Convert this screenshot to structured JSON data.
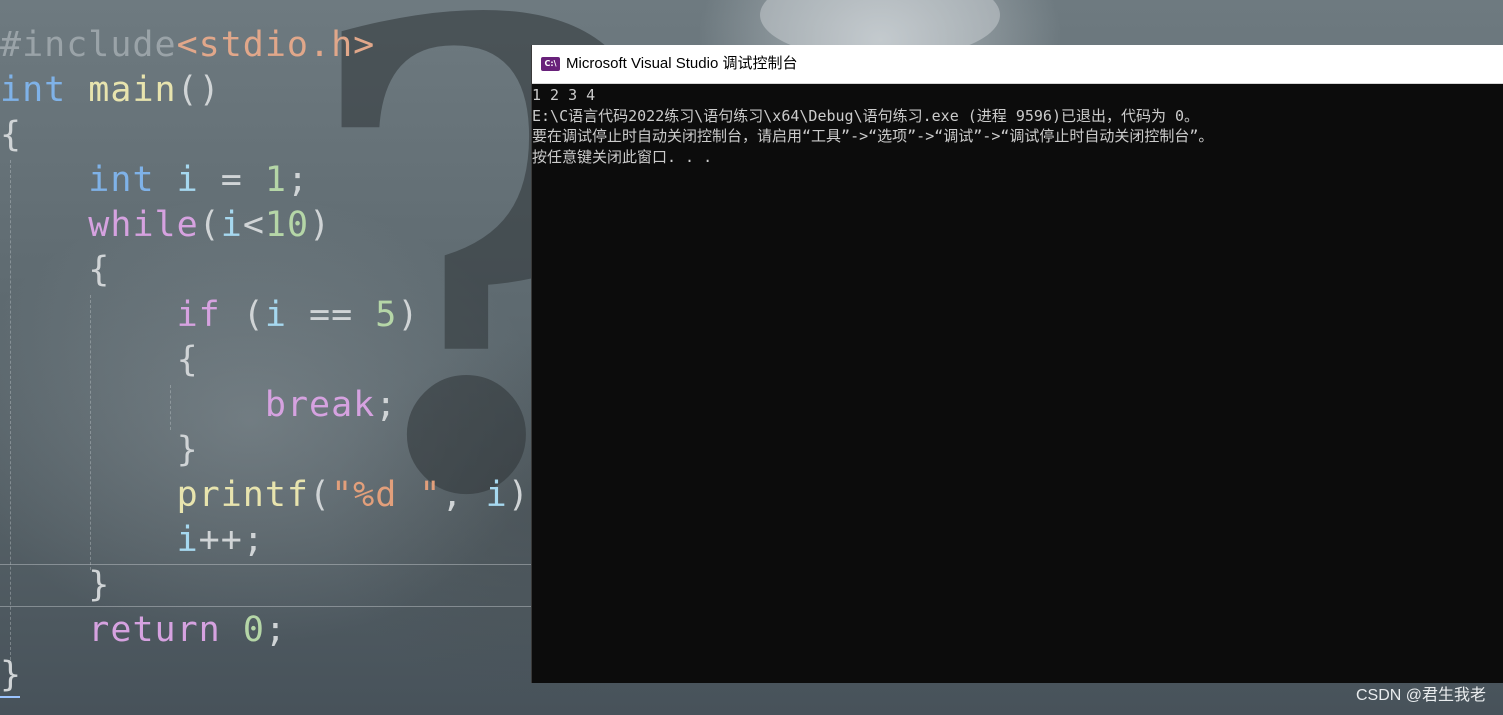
{
  "editor": {
    "lines": [
      [
        {
          "t": "#include",
          "c": "c-pre"
        },
        {
          "t": "<stdio.h>",
          "c": "c-inc"
        }
      ],
      [
        {
          "t": "int",
          "c": "c-kw"
        },
        {
          "t": " ",
          "c": "c-pun"
        },
        {
          "t": "main",
          "c": "c-fn"
        },
        {
          "t": "()",
          "c": "c-pun"
        }
      ],
      [
        {
          "t": "{",
          "c": "c-pun"
        }
      ],
      [
        {
          "t": "    ",
          "c": "c-pun"
        },
        {
          "t": "int",
          "c": "c-kw"
        },
        {
          "t": " ",
          "c": "c-pun"
        },
        {
          "t": "i",
          "c": "c-var"
        },
        {
          "t": " = ",
          "c": "c-pun"
        },
        {
          "t": "1",
          "c": "c-num"
        },
        {
          "t": ";",
          "c": "c-pun"
        }
      ],
      [
        {
          "t": "    ",
          "c": "c-pun"
        },
        {
          "t": "while",
          "c": "c-ctl"
        },
        {
          "t": "(",
          "c": "c-pun"
        },
        {
          "t": "i",
          "c": "c-var"
        },
        {
          "t": "<",
          "c": "c-pun"
        },
        {
          "t": "10",
          "c": "c-num"
        },
        {
          "t": ")",
          "c": "c-pun"
        }
      ],
      [
        {
          "t": "    ",
          "c": "c-pun"
        },
        {
          "t": "{",
          "c": "c-pun"
        }
      ],
      [
        {
          "t": "        ",
          "c": "c-pun"
        },
        {
          "t": "if",
          "c": "c-ctl"
        },
        {
          "t": " (",
          "c": "c-pun"
        },
        {
          "t": "i",
          "c": "c-var"
        },
        {
          "t": " == ",
          "c": "c-pun"
        },
        {
          "t": "5",
          "c": "c-num"
        },
        {
          "t": ")",
          "c": "c-pun"
        }
      ],
      [
        {
          "t": "        ",
          "c": "c-pun"
        },
        {
          "t": "{",
          "c": "c-pun"
        }
      ],
      [
        {
          "t": "            ",
          "c": "c-pun"
        },
        {
          "t": "break",
          "c": "c-ctl"
        },
        {
          "t": ";",
          "c": "c-pun"
        }
      ],
      [
        {
          "t": "        ",
          "c": "c-pun"
        },
        {
          "t": "}",
          "c": "c-pun"
        }
      ],
      [
        {
          "t": "        ",
          "c": "c-pun"
        },
        {
          "t": "printf",
          "c": "c-fn"
        },
        {
          "t": "(",
          "c": "c-pun"
        },
        {
          "t": "\"%d \"",
          "c": "c-str"
        },
        {
          "t": ", ",
          "c": "c-pun"
        },
        {
          "t": "i",
          "c": "c-var"
        },
        {
          "t": ");",
          "c": "c-pun"
        }
      ],
      [
        {
          "t": "        ",
          "c": "c-pun"
        },
        {
          "t": "i",
          "c": "c-var"
        },
        {
          "t": "++;",
          "c": "c-pun"
        }
      ],
      [
        {
          "t": "    ",
          "c": "c-pun"
        },
        {
          "t": "}",
          "c": "c-pun"
        }
      ],
      [
        {
          "t": "    ",
          "c": "c-pun"
        },
        {
          "t": "return",
          "c": "c-ctl"
        },
        {
          "t": " ",
          "c": "c-pun"
        },
        {
          "t": "0",
          "c": "c-num"
        },
        {
          "t": ";",
          "c": "c-pun"
        }
      ],
      [
        {
          "t": "}",
          "c": "c-pun"
        }
      ]
    ]
  },
  "console": {
    "title": "Microsoft Visual Studio 调试控制台",
    "icon": "C:\\",
    "icon_name": "console-app-icon",
    "lines": [
      "1 2 3 4",
      "E:\\C语言代码2022练习\\语句练习\\x64\\Debug\\语句练习.exe (进程 9596)已退出，代码为 0。",
      "要在调试停止时自动关闭控制台，请启用“工具”->“选项”->“调试”->“调试停止时自动关闭控制台”。",
      "按任意键关闭此窗口. . ."
    ]
  },
  "watermark": "CSDN @君生我老",
  "colors": {
    "console_bg": "#0c0c0c",
    "console_text": "#cccccc",
    "titlebar_bg": "#ffffff",
    "vs_icon": "#68217a"
  }
}
